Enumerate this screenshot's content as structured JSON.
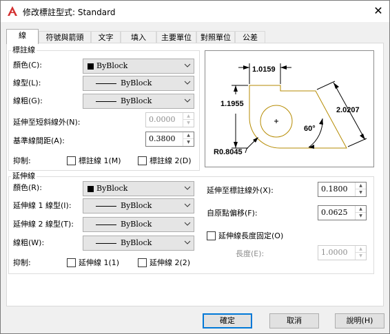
{
  "window": {
    "title": "修改標註型式: Standard",
    "close_glyph": "✕"
  },
  "tabs": [
    {
      "label": "線",
      "active": true
    },
    {
      "label": "符號與箭頭"
    },
    {
      "label": "文字"
    },
    {
      "label": "填入"
    },
    {
      "label": "主要單位"
    },
    {
      "label": "對照單位"
    },
    {
      "label": "公差"
    }
  ],
  "dimlines": {
    "group_title": "標註線",
    "color": {
      "label": "顏色(C):",
      "value": "ByBlock"
    },
    "linetype": {
      "label": "線型(L):",
      "value": "ByBlock"
    },
    "lineweight": {
      "label": "線粗(G):",
      "value": "ByBlock"
    },
    "extend_beyond_ticks": {
      "label": "延伸至短斜線外(N):",
      "value": "0.0000"
    },
    "baseline_spacing": {
      "label": "基準線間距(A):",
      "value": "0.3800"
    },
    "suppress": {
      "label": "抑制:",
      "line1": "標註線 1(M)",
      "line2": "標註線 2(D)"
    }
  },
  "extlines": {
    "group_title": "延伸線",
    "color": {
      "label": "顏色(R):",
      "value": "ByBlock"
    },
    "linetype1": {
      "label": "延伸線 1 線型(I):",
      "value": "ByBlock"
    },
    "linetype2": {
      "label": "延伸線 2 線型(T):",
      "value": "ByBlock"
    },
    "lineweight": {
      "label": "線粗(W):",
      "value": "ByBlock"
    },
    "suppress": {
      "label": "抑制:",
      "line1": "延伸線 1(1)",
      "line2": "延伸線 2(2)"
    },
    "extend_beyond": {
      "label": "延伸至標註線外(X):",
      "value": "0.1800"
    },
    "offset_origin": {
      "label": "自原點偏移(F):",
      "value": "0.0625"
    },
    "fixed_length": {
      "label": "延伸線長度固定(O)"
    },
    "length": {
      "label": "長度(E):",
      "value": "1.0000"
    }
  },
  "preview": {
    "dim_top": "1.0159",
    "dim_left": "1.1955",
    "dim_right": "2.0207",
    "angle": "60°",
    "radius": "R0.8045",
    "colors": {
      "shape": "#b58a00",
      "dim": "#000000"
    }
  },
  "buttons": {
    "ok": "確定",
    "cancel": "取消",
    "help": "說明(H)"
  },
  "colors": {
    "accent": "#0078d7",
    "app_icon": "#d32f2f"
  }
}
